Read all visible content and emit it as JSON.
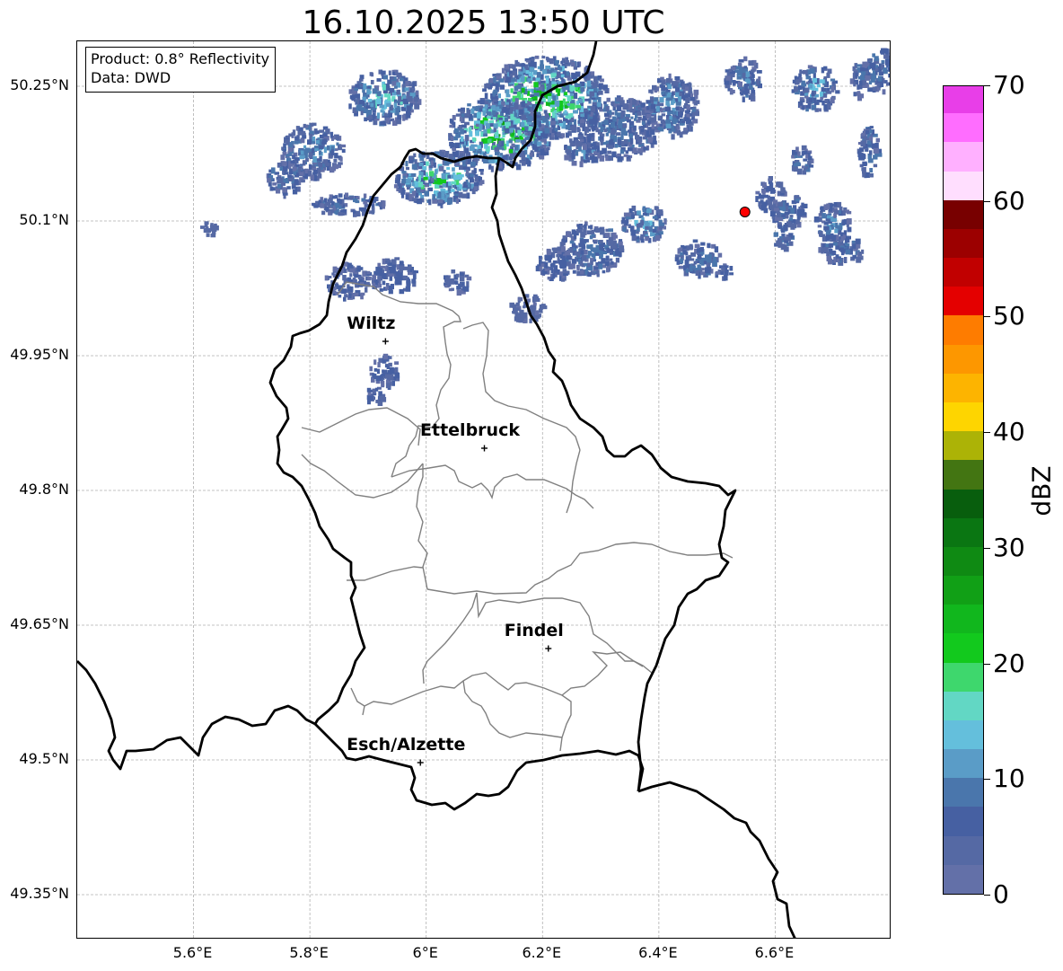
{
  "title": "16.10.2025 13:50 UTC",
  "info_box": {
    "product": "Product: 0.8° Reflectivity",
    "data": "Data: DWD"
  },
  "map": {
    "lon_range": [
      5.4,
      6.8
    ],
    "lat_range": [
      49.3,
      50.3
    ],
    "lat_ticks": [
      {
        "value": 50.25,
        "label": "50.25°N"
      },
      {
        "value": 50.1,
        "label": "50.1°N"
      },
      {
        "value": 49.95,
        "label": "49.95°N"
      },
      {
        "value": 49.8,
        "label": "49.8°N"
      },
      {
        "value": 49.65,
        "label": "49.65°N"
      },
      {
        "value": 49.5,
        "label": "49.5°N"
      },
      {
        "value": 49.35,
        "label": "49.35°N"
      }
    ],
    "lon_ticks": [
      {
        "value": 5.6,
        "label": "5.6°E"
      },
      {
        "value": 5.8,
        "label": "5.8°E"
      },
      {
        "value": 6.0,
        "label": "6°E"
      },
      {
        "value": 6.2,
        "label": "6.2°E"
      },
      {
        "value": 6.4,
        "label": "6.4°E"
      },
      {
        "value": 6.6,
        "label": "6.6°E"
      }
    ],
    "gridlines": true,
    "cities": [
      {
        "name": "Wiltz",
        "lon": 5.93,
        "lat": 49.966
      },
      {
        "name": "Ettelbruck",
        "lon": 6.1,
        "lat": 49.847
      },
      {
        "name": "Findel",
        "lon": 6.21,
        "lat": 49.624
      },
      {
        "name": "Esch/Alzette",
        "lon": 5.99,
        "lat": 49.497
      }
    ],
    "radar_site": {
      "lon": 6.548,
      "lat": 50.11,
      "color": "#ff0000"
    }
  },
  "colorbar": {
    "label": "dBZ",
    "min": 0,
    "max": 70,
    "ticks": [
      "0",
      "10",
      "20",
      "30",
      "40",
      "50",
      "60",
      "70"
    ],
    "colors": [
      "#6370a8",
      "#5569a4",
      "#4660a2",
      "#4a76ac",
      "#5a9cc7",
      "#64bfdc",
      "#62d7c4",
      "#3ed76d",
      "#12c91d",
      "#11b71d",
      "#11a016",
      "#0f8a13",
      "#0a7612",
      "#085e0d",
      "#437512",
      "#acb306",
      "#fed500",
      "#fdb400",
      "#fd9700",
      "#fe7c00",
      "#e40000",
      "#c10000",
      "#9c0000",
      "#780000",
      "#ffdefe",
      "#ffb0ff",
      "#ff6dff",
      "#e83ee8"
    ]
  }
}
